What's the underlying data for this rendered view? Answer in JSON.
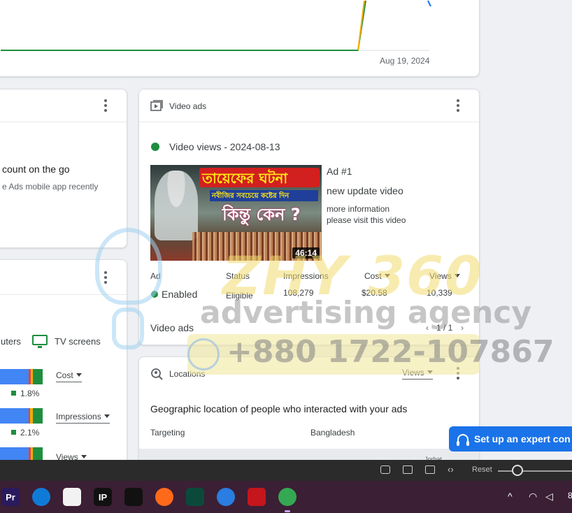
{
  "colors": {
    "accent_blue": "#1a73e8",
    "status_green": "#1e8e3e",
    "bar_blue": "#4285f4",
    "bar_orange": "#f9ab00",
    "bar_red": "#ea4335"
  },
  "performance_chart": {
    "date_label": "Aug 19, 2024"
  },
  "mobile_card": {
    "title": "count on the go",
    "subtitle": "e Ads mobile app recently",
    "menu_icon": "more-vert-icon"
  },
  "devices_card": {
    "legend": {
      "computers_label": "uters",
      "tv_label": "TV screens",
      "tv_icon": "tv-icon"
    },
    "rows": [
      {
        "metric": "Cost",
        "percent": "1.8%"
      },
      {
        "metric": "Impressions",
        "percent": "2.1%"
      },
      {
        "metric": "Views"
      }
    ]
  },
  "video_ads": {
    "header_title": "Video ads",
    "header_icon": "video-ads-icon",
    "campaign_name": "Video views - 2024-08-13",
    "ad": {
      "ad_number": "Ad #1",
      "headline": "new update video",
      "description_line1": "more information",
      "description_line2": "please visit this video",
      "thumbnail": {
        "title_line1": "তায়েফের ঘটনা",
        "title_line2": "নবীজির সবচেয়ে কষ্টের দিন",
        "title_line3": "কিন্তু কেন ?",
        "duration": "46:14"
      }
    },
    "table": {
      "headers": {
        "ad": "Ad",
        "status": "Status",
        "impressions": "Impressions",
        "cost": "Cost",
        "views": "Views"
      },
      "row": {
        "ad_status": "Enabled",
        "status": "Eligible",
        "impressions": "108,279",
        "cost": "$20.58",
        "views": "10,339"
      }
    },
    "footer_link": "Video ads",
    "pagination": "1 / 1"
  },
  "locations": {
    "header_title": "Locations",
    "header_icon": "location-search-icon",
    "metric_select": "Views",
    "description": "Geographic location of people who interacted with your ads",
    "targeting_label": "Targeting",
    "targeting_value": "Bangladesh",
    "map_label": "Jorhat"
  },
  "expert_button": {
    "label": "Set up an expert con",
    "icon": "headset-icon"
  },
  "watermark": {
    "brand": "ZHY 360",
    "tagline": "advertising agency",
    "phone": "+880 1722-107867"
  },
  "viewer_toolbar": {
    "reset_label": "Reset"
  },
  "taskbar": {
    "apps": [
      {
        "name": "premiere-pro",
        "label": "Pr",
        "color": "#2a1a5e"
      },
      {
        "name": "edge",
        "label": "",
        "color": "#0f7bd8"
      },
      {
        "name": "microsoft-store",
        "label": "",
        "color": "#f2f2f2"
      },
      {
        "name": "app-ip",
        "label": "IP",
        "color": "#111111"
      },
      {
        "name": "capcut",
        "label": "",
        "color": "#111111"
      },
      {
        "name": "firefox",
        "label": "",
        "color": "#ff6a1a"
      },
      {
        "name": "app-green",
        "label": "",
        "color": "#0b4a3a"
      },
      {
        "name": "app-sync",
        "label": "",
        "color": "#2a7de1"
      },
      {
        "name": "acrobat",
        "label": "",
        "color": "#c4161c"
      },
      {
        "name": "chrome",
        "label": "",
        "color": "#34a853"
      }
    ],
    "tray_time_partial": "8"
  }
}
